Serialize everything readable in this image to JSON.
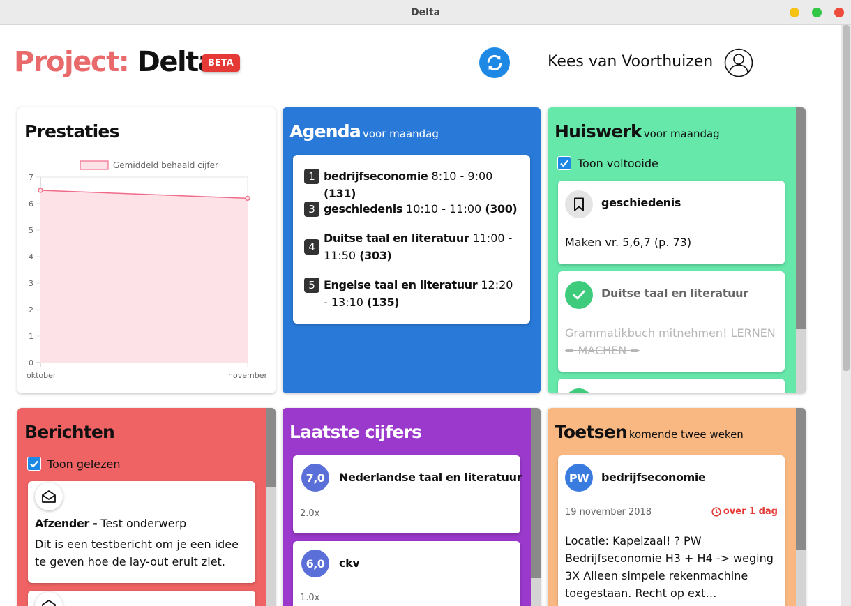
{
  "window": {
    "title": "Delta"
  },
  "header": {
    "brand_prefix": "Project:",
    "brand_name": "Delta",
    "badge": "BETA",
    "user_name": "Kees van Voorthuizen"
  },
  "performance": {
    "title": "Prestaties",
    "chart_data": {
      "type": "area",
      "categories": [
        "oktober",
        "november"
      ],
      "series": [
        {
          "name": "Gemiddeld behaald cijfer",
          "values": [
            6.5,
            6.2
          ]
        }
      ],
      "yticks": [
        "0",
        "1",
        "2",
        "3",
        "4",
        "5",
        "6",
        "7"
      ],
      "ylim": [
        0,
        7
      ],
      "legend": "top",
      "grid": true,
      "colors": {
        "line": "#f06b8a",
        "fill": "#fde3e8"
      }
    }
  },
  "agenda": {
    "title": "Agenda",
    "subtitle": "voor maandag",
    "items": [
      {
        "hour": "1",
        "subject": "bedrijfseconomie",
        "time": "8:10 - 9:00",
        "room": "(131)"
      },
      {
        "hour": "3",
        "subject": "geschiedenis",
        "time": "10:10 - 11:00",
        "room": "(300)"
      },
      {
        "hour": "4",
        "subject": "Duitse taal en literatuur",
        "time": "11:00 - 11:50",
        "room": "(303)"
      },
      {
        "hour": "5",
        "subject": "Engelse taal en literatuur",
        "time": "12:20 - 13:10",
        "room": "(135)"
      }
    ]
  },
  "homework": {
    "title": "Huiswerk",
    "subtitle": "voor maandag",
    "show_completed_label": "Toon voltooide",
    "items": [
      {
        "subject": "geschiedenis",
        "description": "Maken vr. 5,6,7 (p. 73)",
        "done": false,
        "icon": "bookmark-icon"
      },
      {
        "subject": "Duitse taal en literatuur",
        "description": "Grammatikbuch mitnehmen! LERNEN = MACHEN =",
        "done": true,
        "icon": "check-icon"
      }
    ]
  },
  "messages": {
    "title": "Berichten",
    "show_read_label": "Toon gelezen",
    "items": [
      {
        "sender": "Afzender -",
        "subject": "Test onderwerp",
        "body": "Dit is een testbericht om je een idee te geven hoe de lay-out eruit ziet.",
        "icon": "envelope-open-icon"
      }
    ]
  },
  "grades": {
    "title": "Laatste cijfers",
    "items": [
      {
        "grade": "7,0",
        "subject": "Nederlandse taal en literatuur",
        "weight": "2.0x"
      },
      {
        "grade": "6,0",
        "subject": "ckv",
        "weight": "1.0x"
      }
    ]
  },
  "tests": {
    "title": "Toetsen",
    "subtitle": "komende twee weken",
    "items": [
      {
        "type": "PW",
        "subject": "bedrijfseconomie",
        "date": "19 november 2018",
        "due": "over 1 dag",
        "description": "Locatie: Kapelzaal! ? PW Bedrijfseconomie H3 + H4 -> weging 3X Alleen simpele rekenmachine toegestaan. Recht op ext…"
      }
    ]
  },
  "colors": {
    "accent_blue": "#2979d8",
    "homework_green": "#66e8ab",
    "messages_red": "#ef6364",
    "grades_purple": "#9a39cc",
    "tests_orange": "#f9b782",
    "due_red": "#e53935"
  }
}
